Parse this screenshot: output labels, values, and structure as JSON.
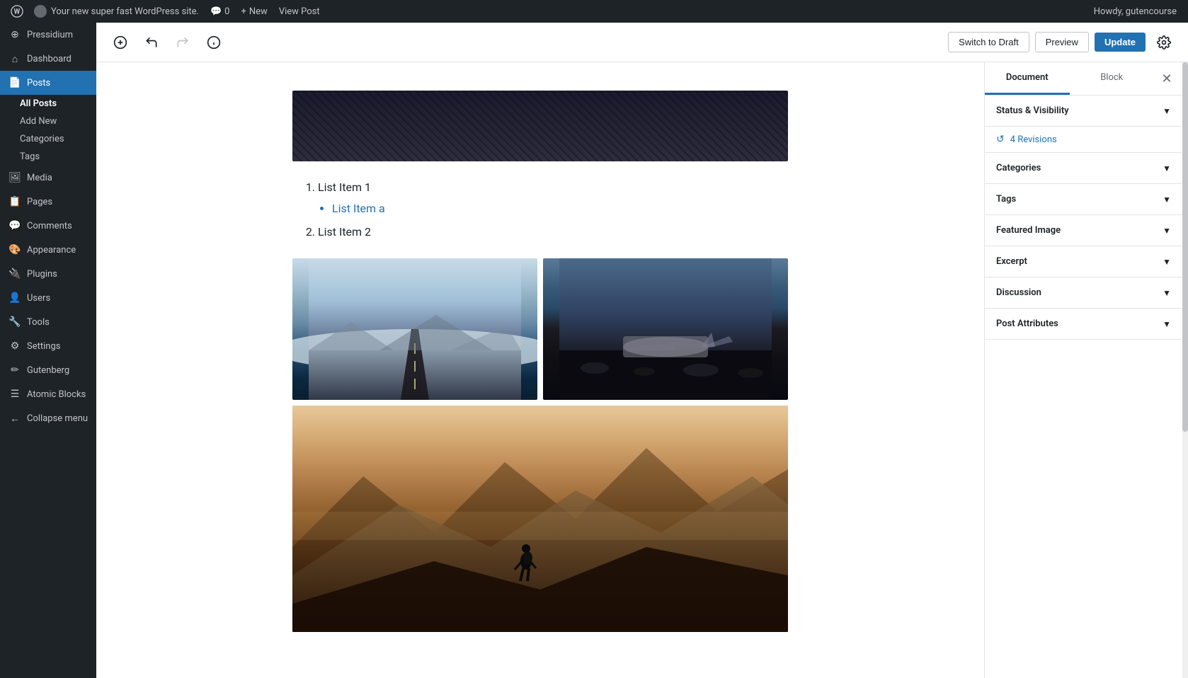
{
  "adminBar": {
    "siteLabel": "Your new super fast WordPress site.",
    "commentsCount": "0",
    "newLabel": "New",
    "viewPostLabel": "View Post",
    "greetingLabel": "Howdy, gutencourse"
  },
  "sidebar": {
    "siteIcon": "⚙",
    "items": [
      {
        "id": "pressidium",
        "label": "Pressidium",
        "icon": "⊕"
      },
      {
        "id": "dashboard",
        "label": "Dashboard",
        "icon": "⌂"
      },
      {
        "id": "posts",
        "label": "Posts",
        "icon": "📄",
        "active": true
      },
      {
        "id": "media",
        "label": "Media",
        "icon": "🖼"
      },
      {
        "id": "pages",
        "label": "Pages",
        "icon": "📋"
      },
      {
        "id": "comments",
        "label": "Comments",
        "icon": "💬"
      },
      {
        "id": "appearance",
        "label": "Appearance",
        "icon": "🎨"
      },
      {
        "id": "plugins",
        "label": "Plugins",
        "icon": "🔌"
      },
      {
        "id": "users",
        "label": "Users",
        "icon": "👤"
      },
      {
        "id": "tools",
        "label": "Tools",
        "icon": "🔧"
      },
      {
        "id": "settings",
        "label": "Settings",
        "icon": "⚙"
      },
      {
        "id": "gutenberg",
        "label": "Gutenberg",
        "icon": "✏"
      },
      {
        "id": "atomic-blocks",
        "label": "Atomic Blocks",
        "icon": "☰"
      },
      {
        "id": "collapse-menu",
        "label": "Collapse menu",
        "icon": "←"
      }
    ],
    "subItems": {
      "posts": [
        {
          "id": "all-posts",
          "label": "All Posts",
          "current": true
        },
        {
          "id": "add-new",
          "label": "Add New"
        },
        {
          "id": "categories",
          "label": "Categories"
        },
        {
          "id": "tags",
          "label": "Tags"
        }
      ]
    }
  },
  "toolbar": {
    "addBlockLabel": "+",
    "undoLabel": "↩",
    "redoLabel": "↪",
    "infoLabel": "ℹ",
    "switchToDraftLabel": "Switch to Draft",
    "previewLabel": "Preview",
    "updateLabel": "Update",
    "settingsLabel": "⚙"
  },
  "editor": {
    "listItems": [
      {
        "id": "item1",
        "text": "List Item 1",
        "type": "ordered",
        "index": 1,
        "children": [
          {
            "id": "item-a",
            "text": "List Item a",
            "type": "unordered"
          }
        ]
      },
      {
        "id": "item2",
        "text": "List Item 2",
        "type": "ordered",
        "index": 2
      }
    ]
  },
  "rightPanel": {
    "documentTabLabel": "Document",
    "blockTabLabel": "Block",
    "closeLabel": "✕",
    "sections": [
      {
        "id": "status-visibility",
        "label": "Status & Visibility",
        "expanded": false
      },
      {
        "id": "revisions",
        "label": "Revisions",
        "count": "4",
        "hasCount": true
      },
      {
        "id": "categories",
        "label": "Categories",
        "expanded": false
      },
      {
        "id": "tags",
        "label": "Tags",
        "expanded": false
      },
      {
        "id": "featured-image",
        "label": "Featured Image",
        "expanded": false
      },
      {
        "id": "excerpt",
        "label": "Excerpt",
        "expanded": false
      },
      {
        "id": "discussion",
        "label": "Discussion",
        "expanded": false
      },
      {
        "id": "post-attributes",
        "label": "Post Attributes",
        "expanded": false
      }
    ],
    "revisionsLabel": "4 Revisions",
    "revisionsIcon": "↺"
  }
}
